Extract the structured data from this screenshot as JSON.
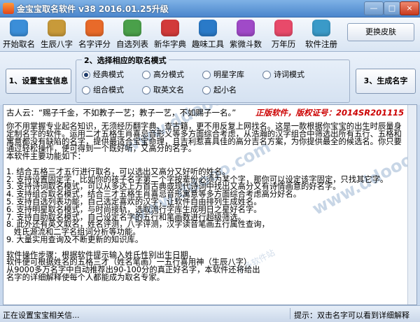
{
  "window": {
    "title": "金宝宝取名软件 v38  2016.01.25升级",
    "min": "—",
    "max": "□",
    "close": "×"
  },
  "toolbar": {
    "items": [
      {
        "label": "开始取名",
        "icon": "people-icon",
        "color": "#3b8ed8"
      },
      {
        "label": "生辰八字",
        "icon": "scroll-icon",
        "color": "#c89a3a"
      },
      {
        "label": "名字评分",
        "icon": "score-icon",
        "color": "#e86a2a"
      },
      {
        "label": "自选列表",
        "icon": "list-icon",
        "color": "#4aa04a"
      },
      {
        "label": "新华字典",
        "icon": "book-icon",
        "color": "#d23a3a"
      },
      {
        "label": "趣味工具",
        "icon": "globe-icon",
        "color": "#2a7ac8"
      },
      {
        "label": "紫微斗数",
        "icon": "star-icon",
        "color": "#a04ac8"
      },
      {
        "label": "万年历",
        "icon": "calendar-icon",
        "color": "#e84a6a"
      },
      {
        "label": "软件注册",
        "icon": "gear-icon",
        "color": "#3a9ac8"
      }
    ],
    "skin_button": "更换皮肤"
  },
  "naming": {
    "set_info_button": "1、设置宝宝信息",
    "generate_button": "3、生成名字",
    "group_label": "2、选择相应的取名模式",
    "modes": [
      {
        "label": "经典模式",
        "checked": true
      },
      {
        "label": "高分模式",
        "checked": false
      },
      {
        "label": "明星字库",
        "checked": false
      },
      {
        "label": "诗词模式",
        "checked": false
      },
      {
        "label": "组合模式",
        "checked": false
      },
      {
        "label": "取英文名",
        "checked": false
      },
      {
        "label": "起小名",
        "checked": false
      }
    ]
  },
  "content": {
    "couplet": "古人云：“赐子千金，不如教子一艺；教子一艺，不如赐子一名。”",
    "registration": "正版软件，版权证号：2014SR201115",
    "body": "你不用掌握专业起名知识，无须经历翻字典、查古籍，更不用反复上网找名。这是一款根据你宝宝的出生时辰量身定制名字的软件。运用二才五格生肖喜忌音形义等多方面综合考虑，从浩瀚的汉字组合中筛选出所有五行、五格和寓意都没有缺陷的名字，提供最适合宝宝命理，且吉利惹喜具佳的高分吉名方案，为你提供最全的候选名。你只要通过轻松操作，便可得到一个既好听，又高分的名字。\n本软件主要功能如下：\n\n1. 结合五格三才五行进行取名，可以选出又高分又好听的姓名。\n2. 支持设置固定字，比如你的孩子名字第二个字按辈份必须为某个字，那你可以设定该字固定，只找其它字。\n3. 支持诗词取名模式，可以从多达上万首古典或现代诗词中找出又高分又有诗情画意的好名字。\n4. 支持组合取名模式，结合三才五格生肖喜忌音形寓意等多方面综合考虑高分好名。\n5. 支持自选列表功能，自己选定喜欢的汉字，让软件自由排列生成姓名。\n6. 支持明星取名模式，与时尚接轨，选取流行字库生成明日之星好名字。\n7. 支持自助取名模式，自己设定名字的五行和笔画数进行超级筛选。\n8. 此外还有英文取名，姓名评测，八字评测，汉字读音笔画五行属性查询，\n   姓氏源流和二字名组词分析等功能。\n9. 大量实用查询及不断更新的知识库。\n\n软件操作步骤：根据软件提示输入姓氏性别出生日期，\n软件便可根据姓名的五格三才（姓名笔画）一五行喜用神（生辰八字）\n从9000多万名字中自动推荐出90-100分的真正好名字，本软件还将给出\n名字的详细解释使每个人都能成为取名专家。",
    "watermark_url": "www.ddooo.com",
    "watermark_cn": "多多软件站"
  },
  "status": {
    "left": "正在设置宝宝相关信...",
    "right": "提示：双击名字可以看到详细解释"
  }
}
